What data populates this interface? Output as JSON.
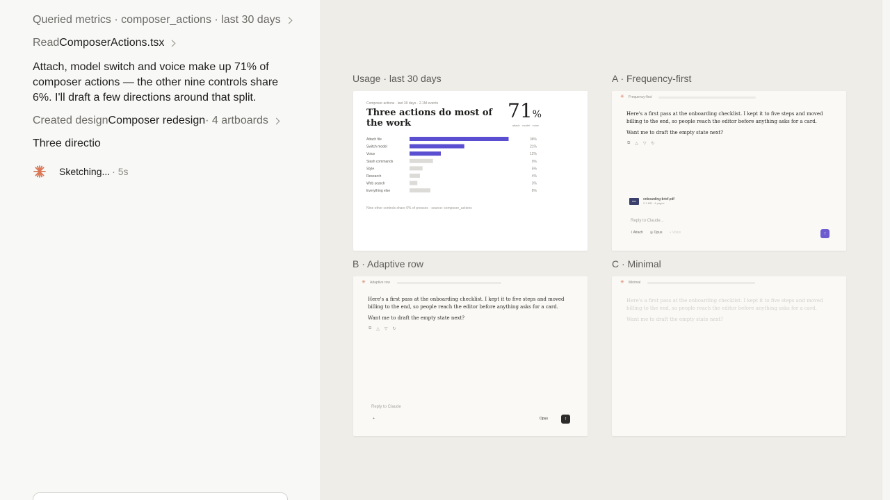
{
  "chat": {
    "steps": [
      {
        "prefix": "Queried metrics · composer_actions · last 30 days",
        "strong": "",
        "suffix": ""
      },
      {
        "prefix": "Read ",
        "strong": "ComposerActions.tsx",
        "suffix": ""
      },
      {
        "prefix": "Created design ",
        "strong": "Composer redesign",
        "suffix": " · 4 artboards"
      }
    ],
    "message": "Attach, model switch and voice make up 71% of composer actions — the other nine controls share 6%. I'll draft a few directions around that split.",
    "typing": "Three directio",
    "status_text": "Sketching...",
    "status_time": "· 5s"
  },
  "artboards": {
    "usage": {
      "label": "Usage · last 30 days",
      "kicker": "Composer actions · last 30 days · 2.1M events",
      "title": "Three actions do most of the work",
      "big_value": "71",
      "big_unit": "%",
      "big_sub": "attach · model · voice",
      "footnote": "Nine other controls share 6% of presses · source: composer_actions"
    },
    "freq": {
      "label": "A · Frequency-first",
      "header": "Frequency-first",
      "message": "Here's a first pass at the onboarding checklist. I kept it to five steps and moved billing to the end, so people reach the editor before anything asks for a card.",
      "question": "Want me to draft the empty state next?",
      "attachment_name": "onboarding-brief.pdf",
      "attachment_meta": "2.1 MB · 4 pages",
      "attachment_type": "PDF",
      "reply_placeholder": "Reply to Claude...",
      "attach_label": "Attach",
      "model_label": "Opus",
      "voice_label": "Voice",
      "accent": "#6c5ccf"
    },
    "adaptive": {
      "label": "B · Adaptive row",
      "header": "Adaptive row",
      "message": "Here's a first pass at the onboarding checklist. I kept it to five steps and moved billing to the end, so people reach the editor before anything asks for a card.",
      "question": "Want me to draft the empty state next?",
      "reply_placeholder": "Reply to Claude",
      "plus": "+",
      "model_label": "Opus"
    },
    "minimal": {
      "label": "C · Minimal",
      "header": "Minimal",
      "message": "Here's a first pass at the onboarding checklist. I kept it to five steps and moved billing to the end, so people reach the editor before anything asks for a card.",
      "question": "Want me to draft the empty state next?"
    }
  },
  "chart_data": {
    "type": "bar",
    "orientation": "horizontal",
    "categories": [
      "Attach file",
      "Switch model",
      "Voice",
      "Slash commands",
      "Style",
      "Research",
      "Web search",
      "Everything else"
    ],
    "values": [
      38,
      21,
      12,
      9,
      5,
      4,
      3,
      8
    ],
    "value_labels": [
      "38%",
      "21%",
      "12%",
      "9%",
      "5%",
      "4%",
      "3%",
      "8%"
    ],
    "highlight_count": 3,
    "xlim": [
      0,
      40
    ],
    "colors": {
      "highlight": "#5b4fd1",
      "muted": "#dcdbd7"
    }
  }
}
